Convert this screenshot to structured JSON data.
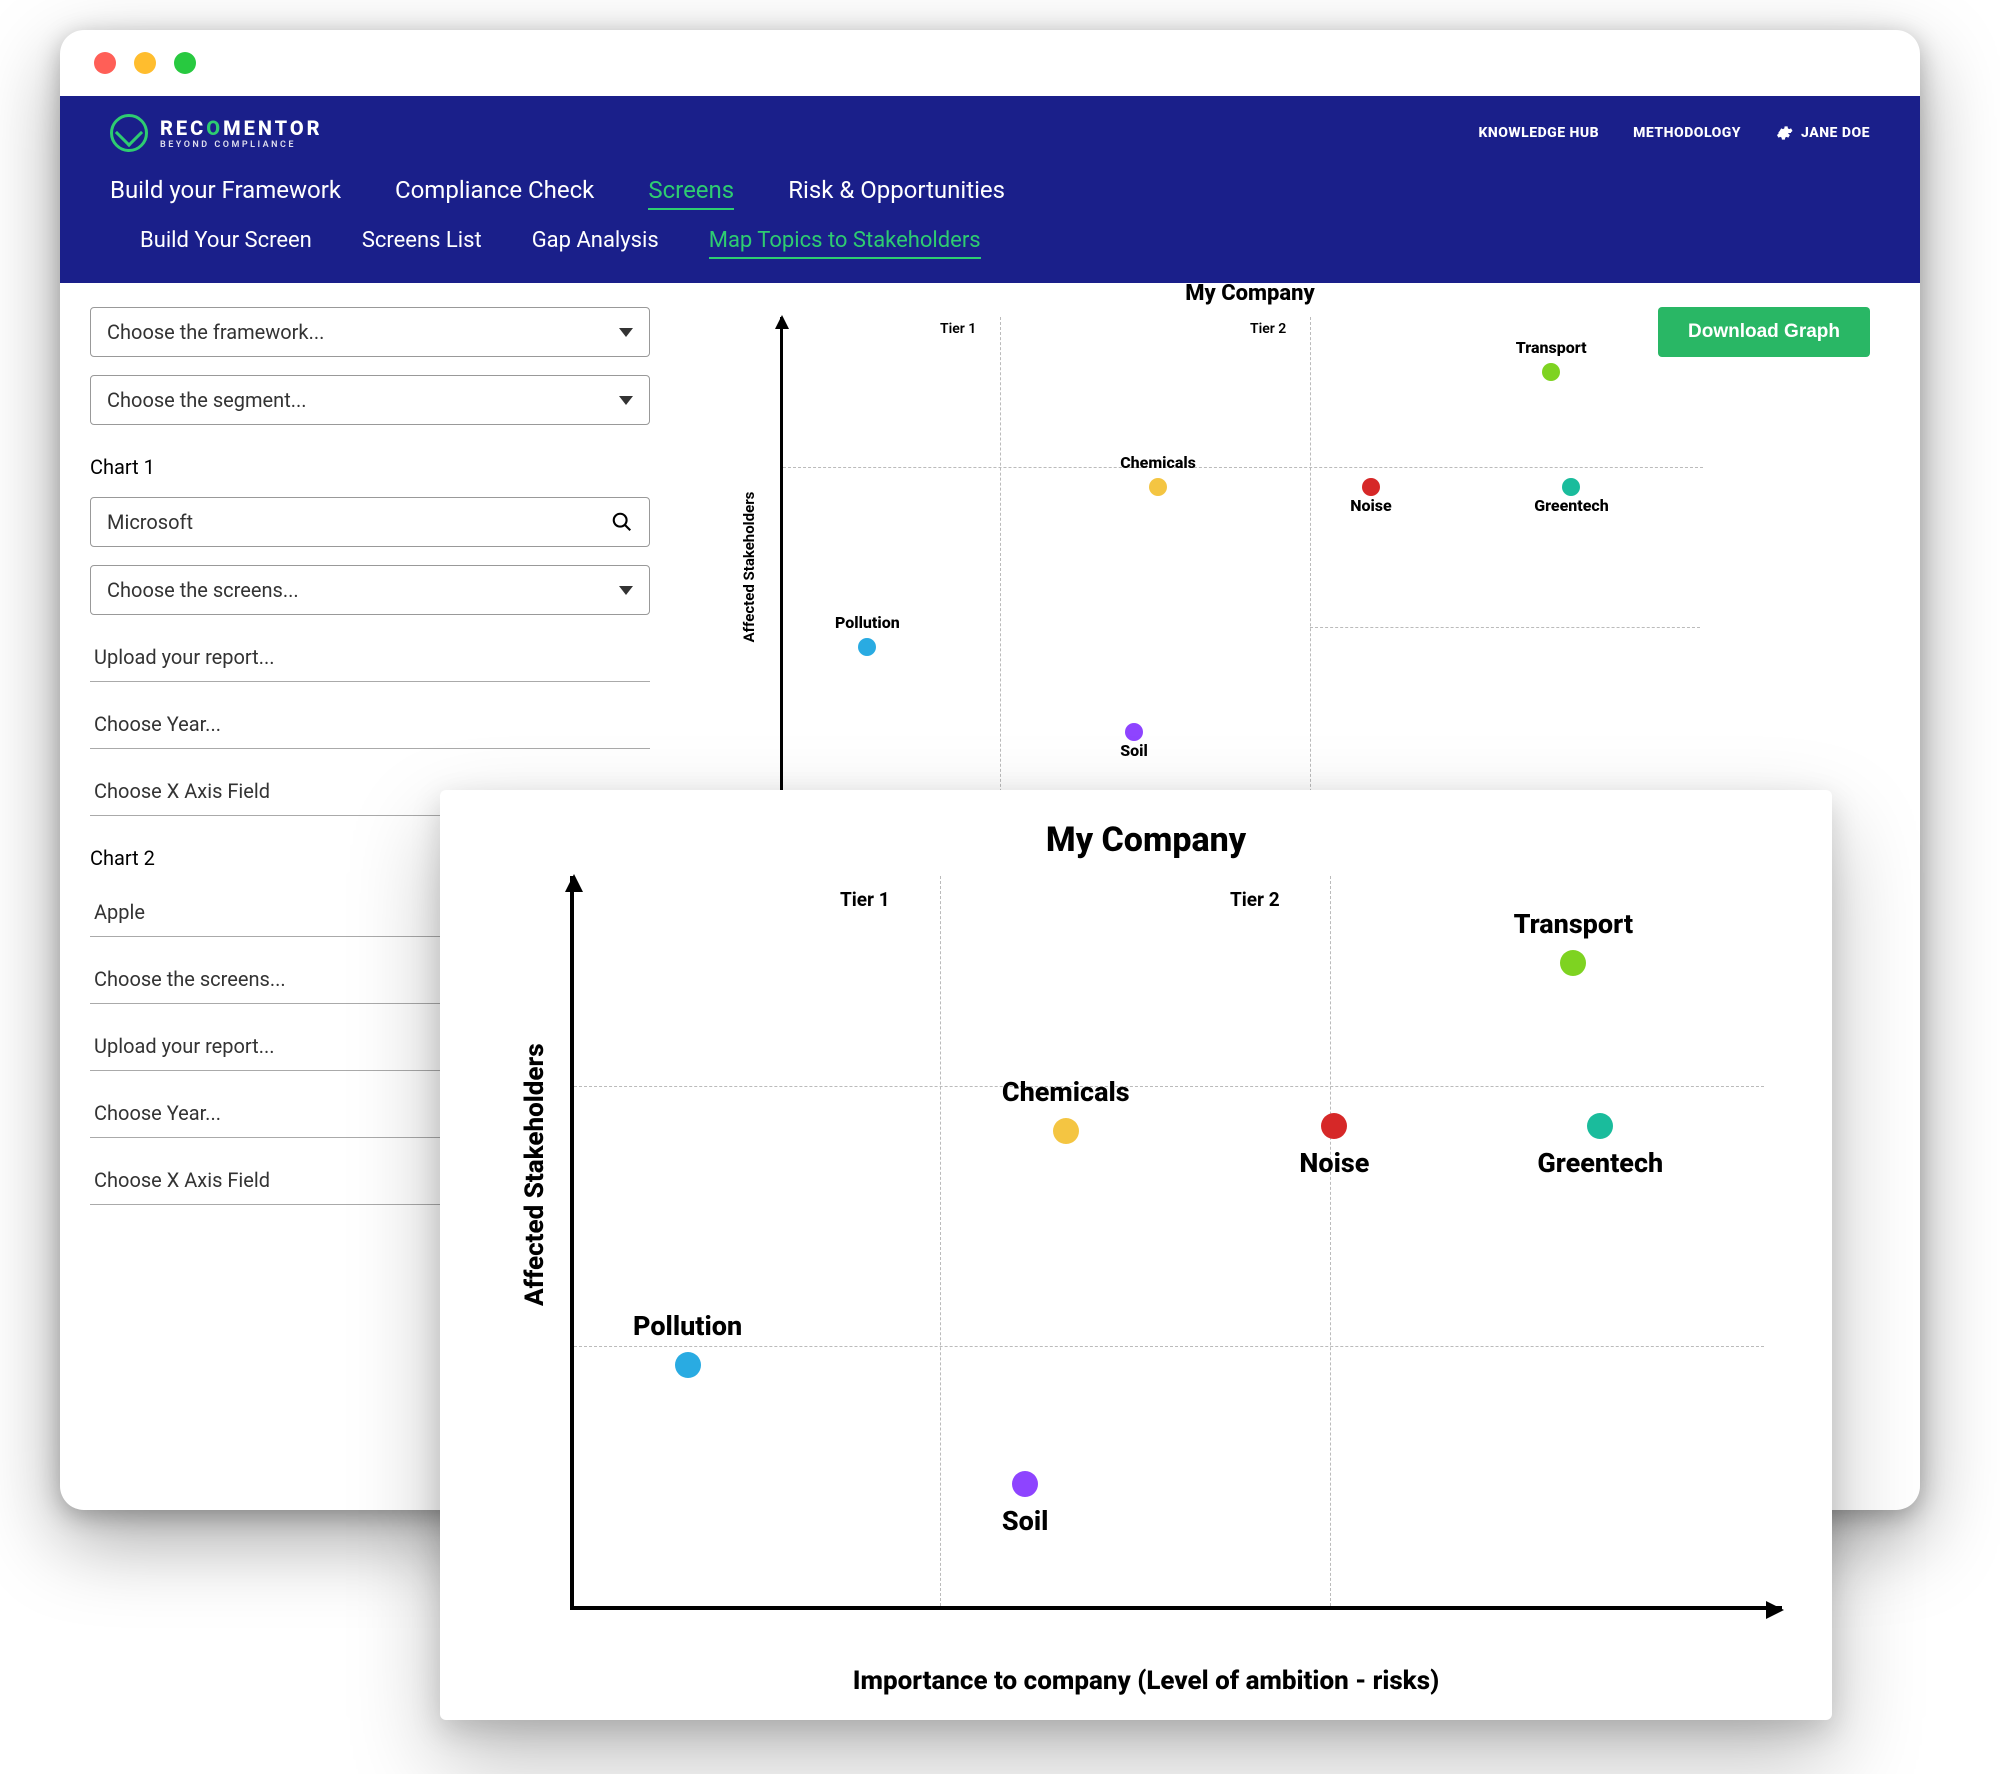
{
  "brand": {
    "name_a": "REC",
    "name_b": "O",
    "name_c": "MENTOR",
    "tagline": "BEYOND COMPLIANCE"
  },
  "header_links": {
    "knowledge": "KNOWLEDGE HUB",
    "methodology": "METHODOLOGY"
  },
  "user": {
    "name": "JANE DOE"
  },
  "nav_primary": {
    "build": "Build your Framework",
    "compliance": "Compliance Check",
    "screens": "Screens",
    "risk": "Risk & Opportunities"
  },
  "nav_secondary": {
    "build_screen": "Build Your Screen",
    "screens_list": "Screens List",
    "gap": "Gap Analysis",
    "map": "Map Topics to Stakeholders"
  },
  "selects": {
    "framework": "Choose the framework...",
    "segment": "Choose the segment..."
  },
  "chart1": {
    "label": "Chart 1",
    "company": "Microsoft",
    "screens": "Choose the screens...",
    "upload": "Upload your report...",
    "year": "Choose Year...",
    "xfield": "Choose X Axis Field"
  },
  "chart2": {
    "label": "Chart 2",
    "company": "Apple",
    "screens": "Choose the screens...",
    "upload": "Upload your report...",
    "year": "Choose Year...",
    "xfield": "Choose X Axis Field"
  },
  "download_btn": "Download Graph",
  "mini_chart": {
    "title": "My Company",
    "ylabel": "Affected Stakeholders",
    "tier1": "Tier 1",
    "tier2": "Tier 2"
  },
  "big_chart": {
    "title": "My Company",
    "ylabel": "Affected Stakeholders",
    "xlabel": "Importance to company  (Level of ambition - risks)",
    "tier1": "Tier 1",
    "tier2": "Tier 2"
  },
  "chart_data": {
    "type": "scatter",
    "title": "My Company",
    "xlabel": "Importance to company (Level of ambition - risks)",
    "ylabel": "Affected Stakeholders",
    "xlim": [
      0,
      10
    ],
    "ylim": [
      0,
      10
    ],
    "tier_lines_x": [
      3.3,
      6.6
    ],
    "tier_labels": [
      "Tier 1",
      "Tier 2"
    ],
    "grid_lines_y": [
      3.7,
      7.3
    ],
    "series": [
      {
        "name": "Pollution",
        "x": 1.0,
        "y": 3.4,
        "color": "#29abe2",
        "label_pos": "above"
      },
      {
        "name": "Chemicals",
        "x": 4.1,
        "y": 6.6,
        "color": "#f4c542",
        "label_pos": "above"
      },
      {
        "name": "Soil",
        "x": 4.1,
        "y": 1.8,
        "color": "#8e44ff",
        "label_pos": "below"
      },
      {
        "name": "Noise",
        "x": 6.6,
        "y": 6.7,
        "color": "#d62828",
        "label_pos": "below"
      },
      {
        "name": "Greentech",
        "x": 8.6,
        "y": 6.7,
        "color": "#1abc9c",
        "label_pos": "below"
      },
      {
        "name": "Transport",
        "x": 8.4,
        "y": 8.9,
        "color": "#7ed321",
        "label_pos": "above"
      }
    ]
  }
}
